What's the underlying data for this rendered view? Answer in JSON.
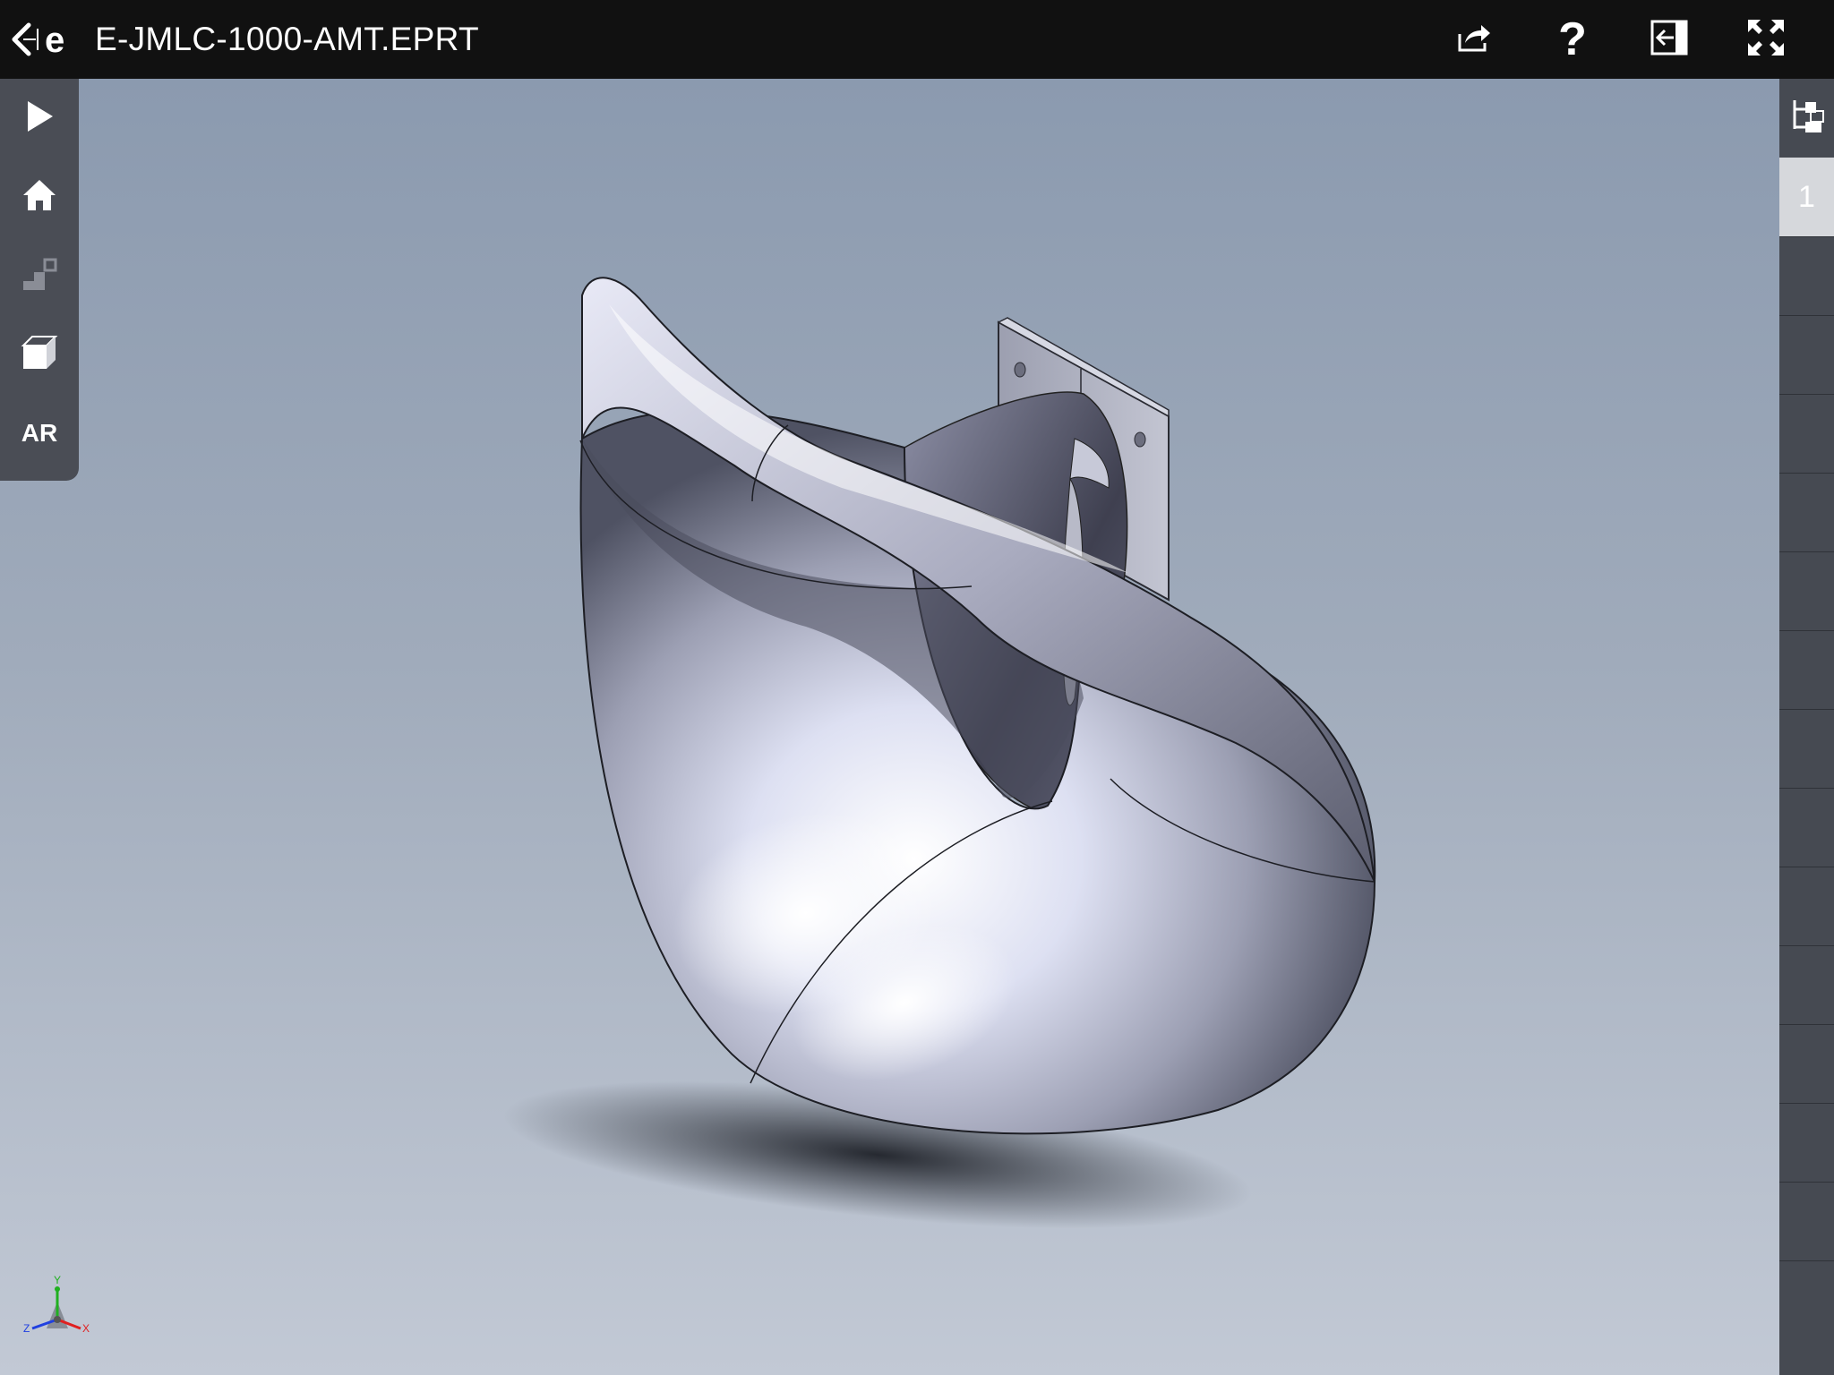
{
  "header": {
    "title": "E-JMLC-1000-AMT.EPRT",
    "back_icon": "back-arrow-icon",
    "logo_icon": "edrawings-logo-icon",
    "actions": [
      {
        "name": "share",
        "icon": "share-icon"
      },
      {
        "name": "help",
        "icon": "help-icon",
        "glyph": "?"
      },
      {
        "name": "collapse-panel",
        "icon": "collapse-panel-icon"
      },
      {
        "name": "fullscreen",
        "icon": "fullscreen-icon"
      }
    ]
  },
  "left_toolbar": {
    "items": [
      {
        "name": "play",
        "icon": "play-icon"
      },
      {
        "name": "home",
        "icon": "home-icon"
      },
      {
        "name": "steps",
        "icon": "steps-icon"
      },
      {
        "name": "view-orientation",
        "icon": "view-cube-icon"
      },
      {
        "name": "ar",
        "label": "AR"
      }
    ]
  },
  "right_panel": {
    "tree_icon": "feature-tree-icon",
    "active_tab": "1"
  },
  "triad": {
    "x": "X",
    "y": "Y",
    "z": "Z"
  },
  "colors": {
    "toolbar_bg": "#111111",
    "panel_bg": "#4a4d55",
    "model_surface": "#b9bccb",
    "background_top": "#8b9aaf",
    "background_bottom": "#c2c9d5",
    "axis_x": "#e02020",
    "axis_y": "#20b020",
    "axis_z": "#2040e0"
  }
}
